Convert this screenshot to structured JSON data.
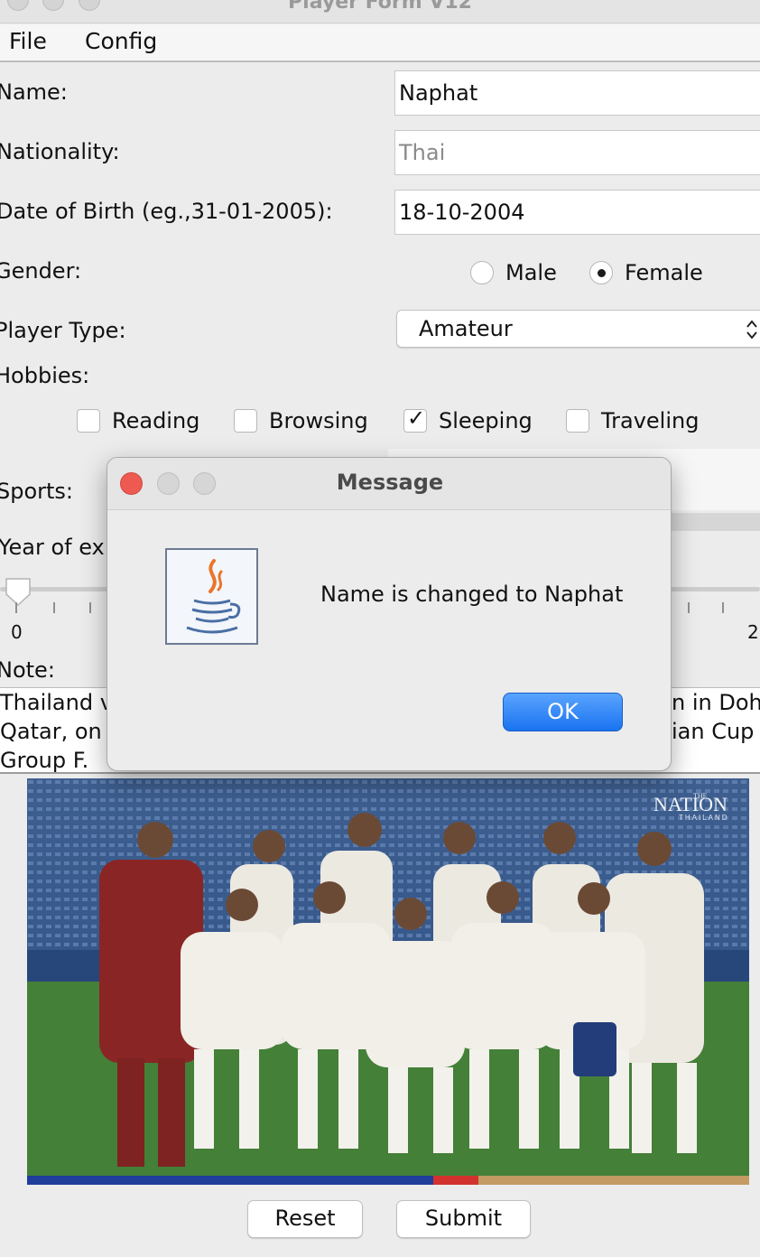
{
  "window": {
    "title": "Player Form V12"
  },
  "menu": {
    "file": "File",
    "config": "Config"
  },
  "form": {
    "name_label": "Name:",
    "name_value": "Naphat",
    "nationality_label": "Nationality:",
    "nationality_placeholder": "Thai",
    "dob_label": "Date of Birth (eg.,31-01-2005):",
    "dob_value": "18-10-2004",
    "gender_label": "Gender:",
    "gender_male": "Male",
    "gender_female": "Female",
    "gender_selected": "Female",
    "player_type_label": "Player Type:",
    "player_type_value": "Amateur",
    "hobbies_label": "Hobbies:",
    "hobbies": [
      {
        "label": "Reading",
        "checked": false
      },
      {
        "label": "Browsing",
        "checked": false
      },
      {
        "label": "Sleeping",
        "checked": true
      },
      {
        "label": "Traveling",
        "checked": false
      }
    ],
    "sports_label": "Sports:",
    "year_label": "Year of ex",
    "slider": {
      "min_label": "0",
      "max_label": "2",
      "value_fraction": 0.0
    },
    "note_label": "Note:",
    "note_lines": [
      {
        "left": "Thailand v",
        "right": "n in Doh"
      },
      {
        "left": "Qatar, on",
        "right": "ian Cup"
      },
      {
        "left": "Group F.",
        "right": ""
      }
    ]
  },
  "photo": {
    "watermark_top": "THE",
    "watermark_main": "NATION",
    "watermark_sub": "THAILAND"
  },
  "buttons": {
    "reset": "Reset",
    "submit": "Submit"
  },
  "dialog": {
    "title": "Message",
    "message": "Name is changed to Naphat",
    "ok": "OK"
  },
  "colors": {
    "accent": "#1a73f0",
    "close_dot": "#ee5a52"
  }
}
